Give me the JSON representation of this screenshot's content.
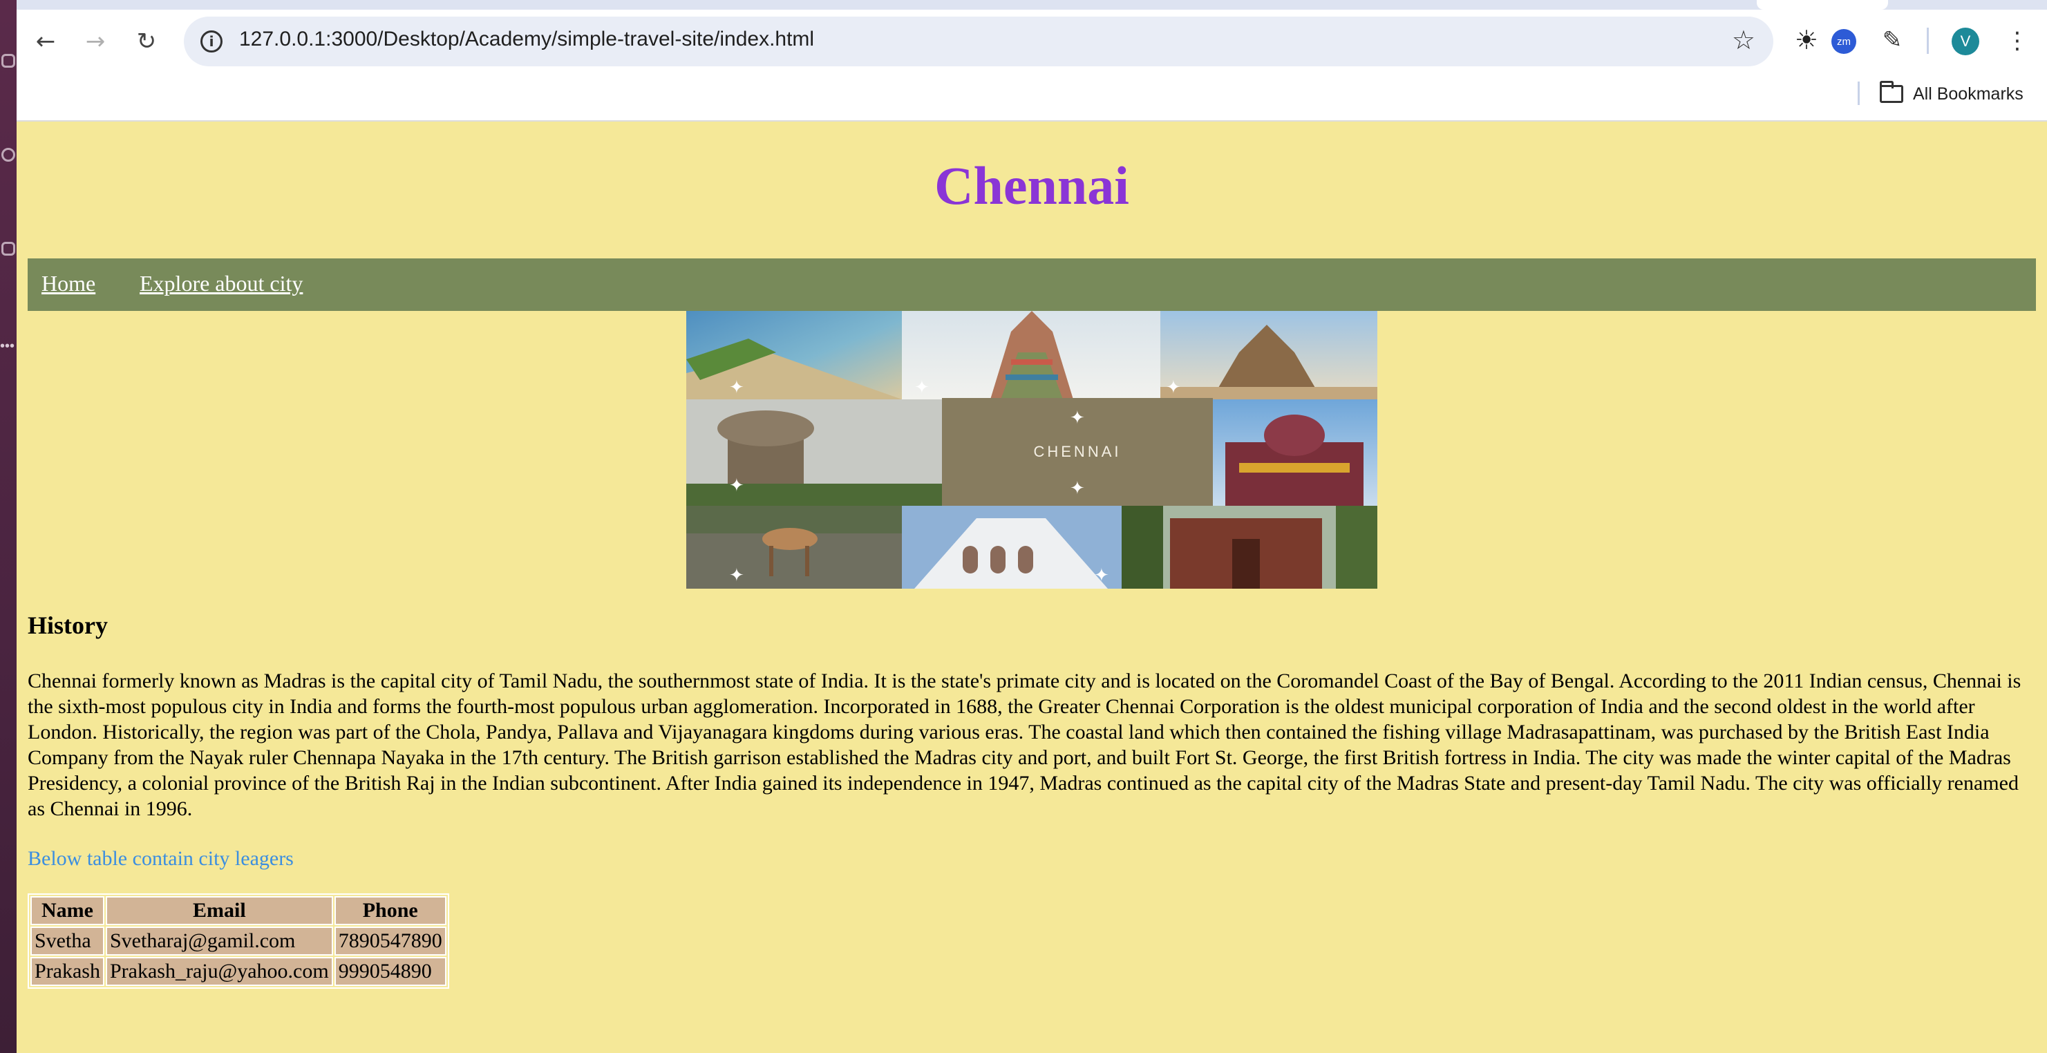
{
  "browser": {
    "url": "127.0.0.1:3000/Desktop/Academy/simple-travel-site/index.html",
    "icons": {
      "back": "back-arrow-icon",
      "forward": "forward-arrow-icon",
      "reload": "reload-icon",
      "site_info": "info-icon",
      "bookmark_star": "star-icon",
      "extension_1": "sun-icon",
      "extension_2": "zoom-icon",
      "extensions": "puzzle-icon",
      "menu": "kebab-menu-icon",
      "bookmarks_folder": "folder-icon"
    },
    "zoom_ext_label": "zm",
    "profile_initial": "V",
    "bookmarks_label": "All Bookmarks"
  },
  "page": {
    "title": "Chennai",
    "nav": [
      "Home",
      "Explore about city"
    ],
    "collage_label": "CHENNAI",
    "history_heading": "History",
    "history_text": "Chennai formerly known as Madras is the capital city of Tamil Nadu, the southernmost state of India. It is the state's primate city and is located on the Coromandel Coast of the Bay of Bengal. According to the 2011 Indian census, Chennai is the sixth-most populous city in India and forms the fourth-most populous urban agglomeration. Incorporated in 1688, the Greater Chennai Corporation is the oldest municipal corporation of India and the second oldest in the world after London. Historically, the region was part of the Chola, Pandya, Pallava and Vijayanagara kingdoms during various eras. The coastal land which then contained the fishing village Madrasapattinam, was purchased by the British East India Company from the Nayak ruler Chennapa Nayaka in the 17th century. The British garrison established the Madras city and port, and built Fort St. George, the first British fortress in India. The city was made the winter capital of the Madras Presidency, a colonial province of the British Raj in the Indian subcontinent. After India gained its independence in 1947, Madras continued as the capital city of the Madras State and present-day Tamil Nadu. The city was officially renamed as Chennai in 1996.",
    "table_note": "Below table contain city leagers",
    "table": {
      "headers": [
        "Name",
        "Email",
        "Phone"
      ],
      "rows": [
        [
          "Svetha",
          "Svetharaj@gamil.com",
          "7890547890"
        ],
        [
          "Prakash",
          "Prakash_raju@yahoo.com",
          "999054890"
        ]
      ]
    }
  },
  "colors": {
    "page_bg": "#f5e898",
    "title": "#8a35d6",
    "nav_bg": "#788a5a",
    "nav_link": "#ffffff",
    "note": "#3b8ee0",
    "table_cell": "#d2b496"
  }
}
